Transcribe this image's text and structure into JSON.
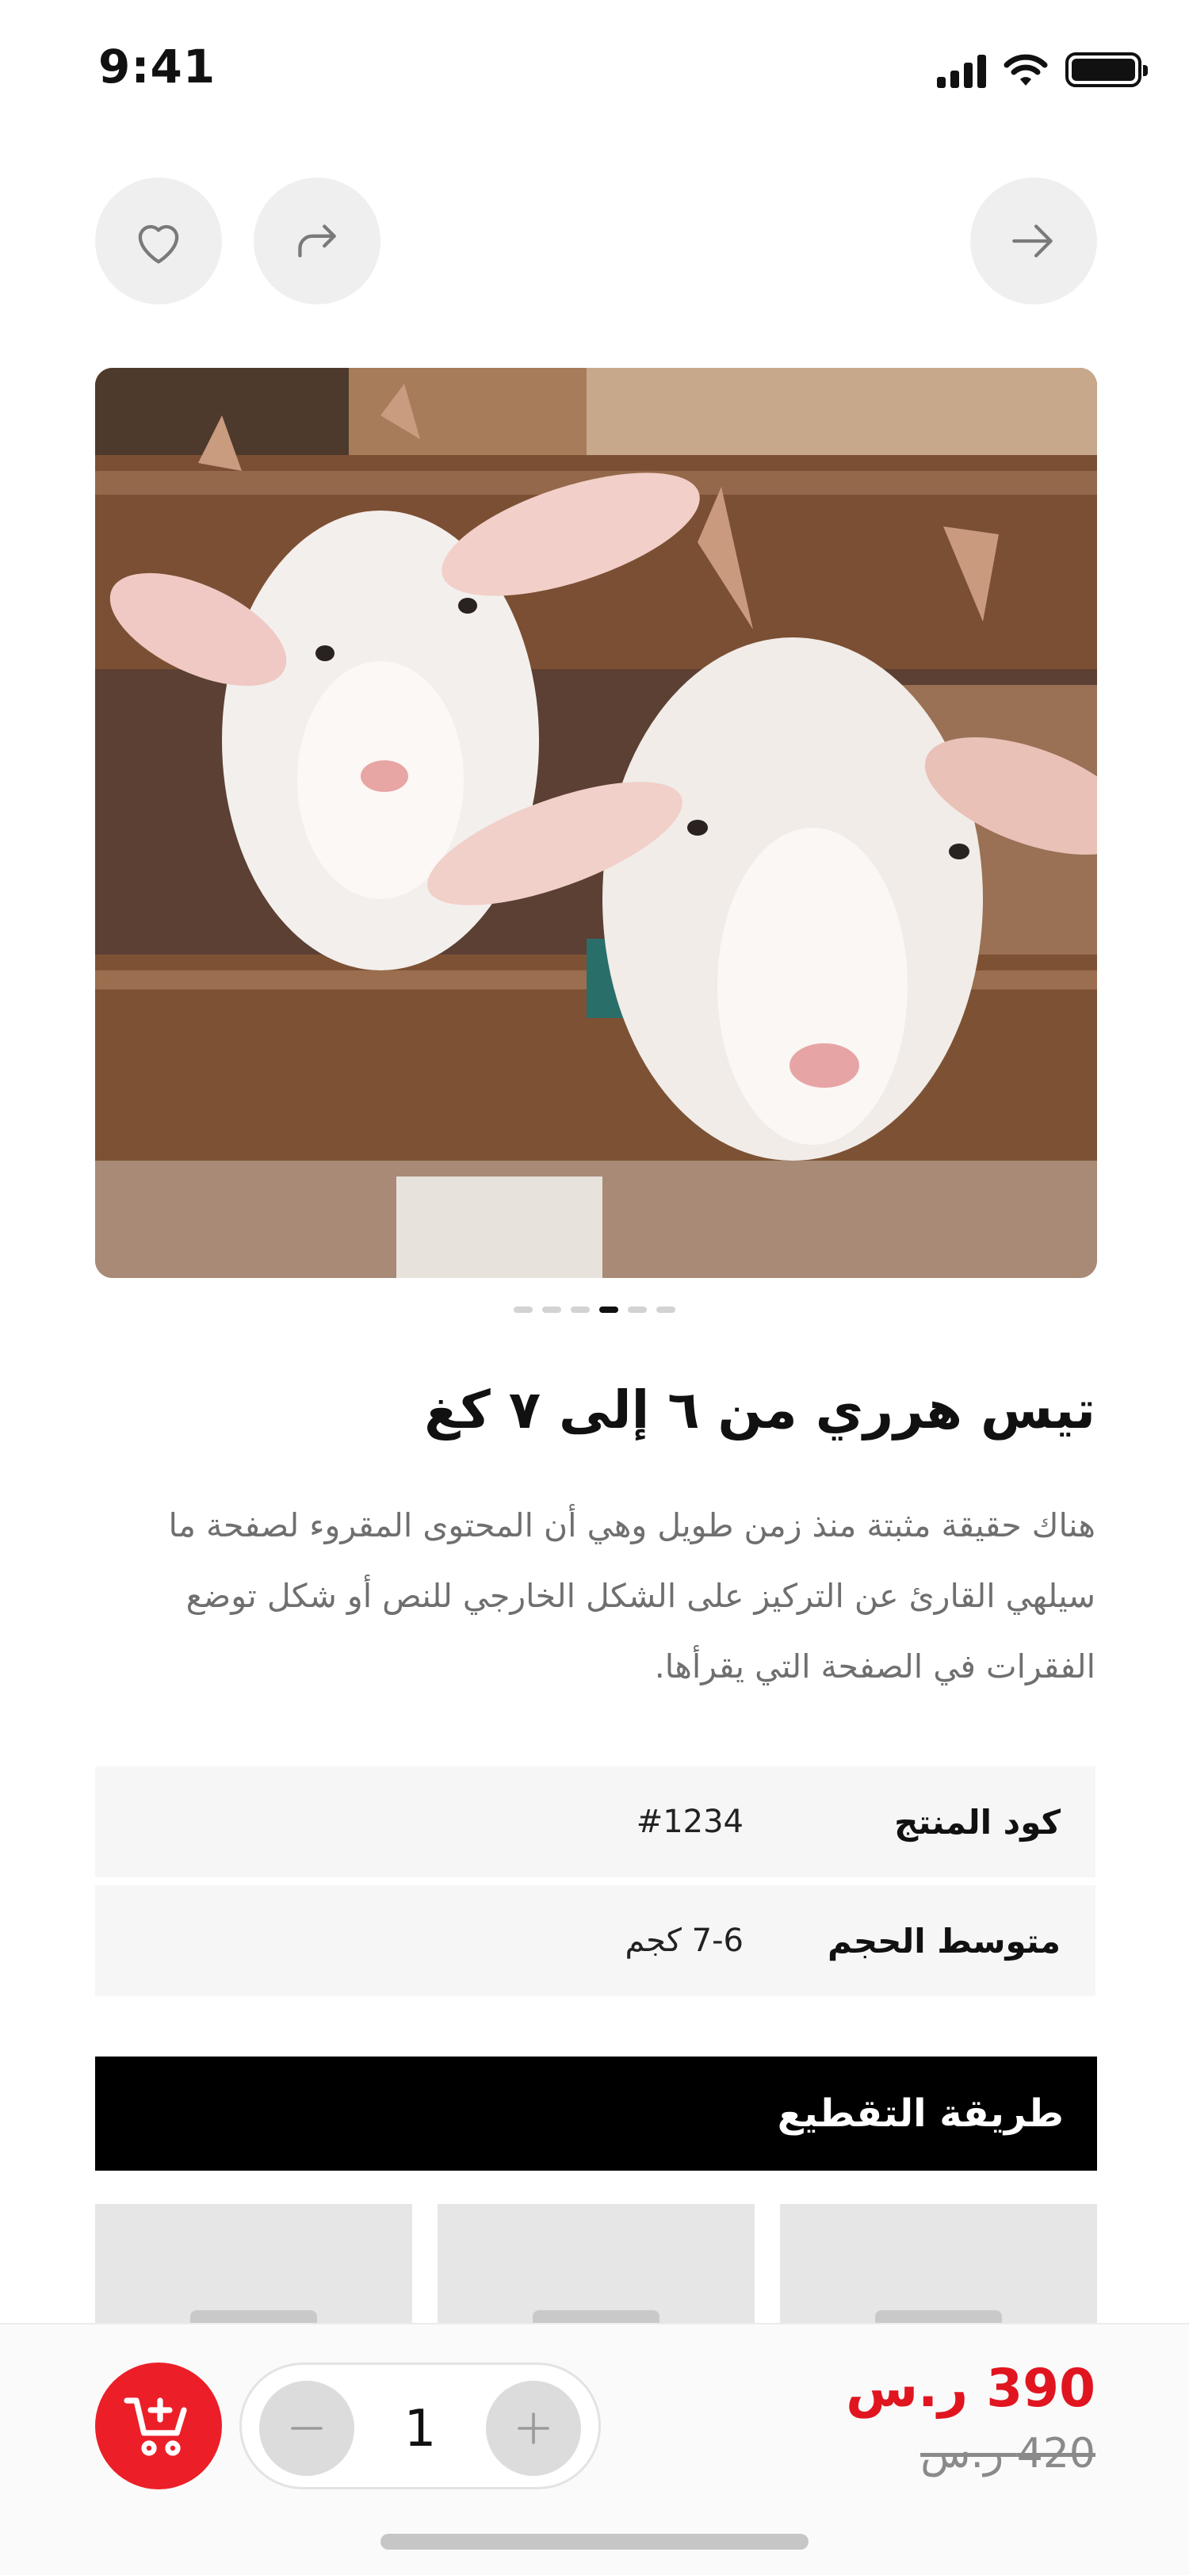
{
  "status_bar": {
    "time": "9:41"
  },
  "product": {
    "title": "تيس هرري من ٦ إلى ٧ كغ",
    "description": "هناك حقيقة مثبتة منذ زمن طويل وهي أن المحتوى المقروء لصفحة ما سيلهي القارئ عن التركيز على الشكل الخارجي للنص أو شكل توضع الفقرات في الصفحة التي يقرأها.",
    "gallery": {
      "slide_count": 6,
      "active_index": 3
    }
  },
  "specs": [
    {
      "label": "كود المنتج",
      "value": "#1234"
    },
    {
      "label": "متوسط الحجم",
      "value": "7-6 كجم"
    }
  ],
  "cutting": {
    "title": "طريقة التقطيع",
    "card_count": 3
  },
  "cart": {
    "quantity": "1"
  },
  "price": {
    "current": "390 ر.س",
    "original": "420 ر.س"
  },
  "colors": {
    "accent": "#ec1f28",
    "price": "#e0151f",
    "section_bar": "#000000",
    "muted_bg": "#efefef"
  },
  "icons": {
    "favorite": "heart-icon",
    "share": "share-icon",
    "back": "arrow-right-icon",
    "add_to_cart": "cart-plus-icon",
    "decrement": "minus-icon",
    "increment": "plus-icon"
  }
}
